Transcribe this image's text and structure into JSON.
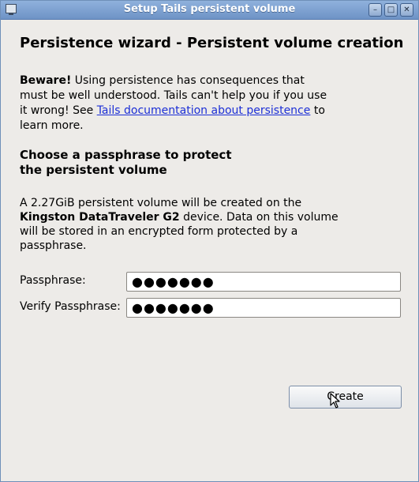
{
  "window": {
    "title": "Setup Tails persistent volume",
    "buttons": {
      "minimize": "–",
      "maximize": "□",
      "close": "✕"
    }
  },
  "content": {
    "heading": "Persistence wizard - Persistent volume creation",
    "warning": {
      "bold": "Beware!",
      "text_before_link": " Using persistence has consequences that must be well understood. Tails can't help you if you use it wrong! See ",
      "link_text": "Tails documentation about persistence",
      "text_after_link": " to learn more."
    },
    "subheading": {
      "line1": "Choose a passphrase to protect",
      "line2": "the persistent volume"
    },
    "info": {
      "prefix": "A 2.27GiB persistent volume will be created on the ",
      "device": "Kingston DataTraveler G2",
      "suffix": " device. Data on this volume will be stored in an encrypted form protected by a passphrase."
    },
    "passphrase": {
      "label": "Passphrase:",
      "value": "●●●●●●●"
    },
    "verify": {
      "label": "Verify Passphrase:",
      "value": "●●●●●●●"
    },
    "create_button": "Create"
  }
}
